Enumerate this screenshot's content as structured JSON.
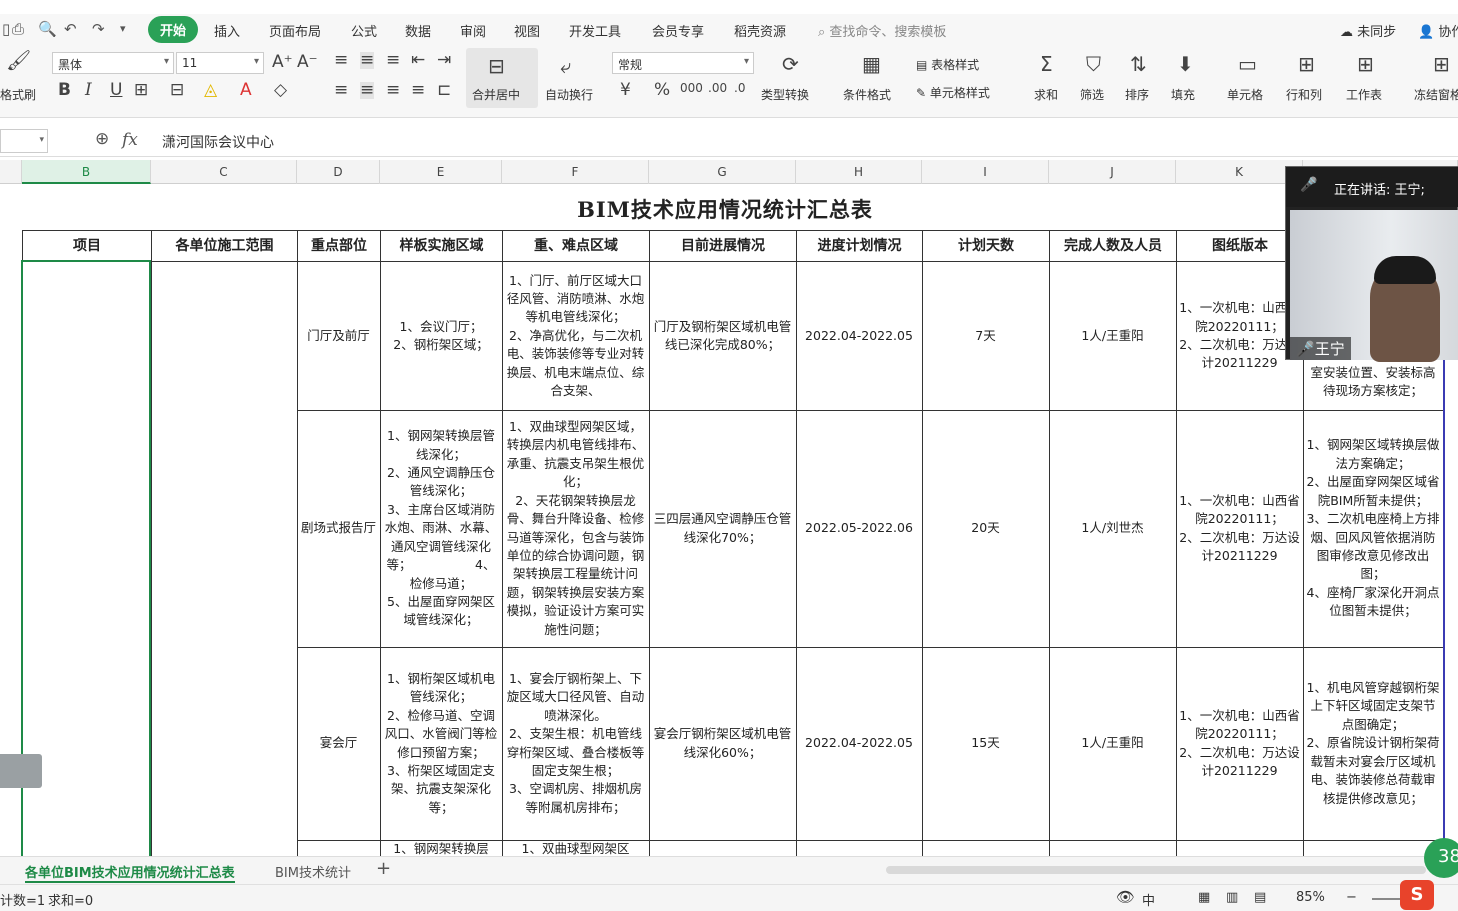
{
  "menubar": {
    "items": [
      "开始",
      "插入",
      "页面布局",
      "公式",
      "数据",
      "审阅",
      "视图",
      "开发工具",
      "会员专享",
      "稻壳资源"
    ],
    "search_placeholder": "查找命令、搜索模板",
    "sync": "未同步",
    "collab": "协作"
  },
  "ribbon": {
    "format_brush": "格式刷",
    "font_name": "黑体",
    "font_size": "11",
    "merge_center": "合并居中",
    "wrap_text": "自动换行",
    "number_format": "常规",
    "type_convert": "类型转换",
    "cond_format": "条件格式",
    "table_style": "表格样式",
    "cell_style": "单元格样式",
    "sum": "求和",
    "filter": "筛选",
    "sort": "排序",
    "fill": "填充",
    "cell": "单元格",
    "row_col": "行和列",
    "worksheet": "工作表",
    "freeze": "冻结窗格"
  },
  "formula_bar": {
    "fx": "fx",
    "content": "潇河国际会议中心"
  },
  "columns": [
    "B",
    "C",
    "D",
    "E",
    "F",
    "G",
    "H",
    "I",
    "J",
    "K"
  ],
  "sheet": {
    "title": "BIM技术应用情况统计汇总表",
    "headers": [
      "项目",
      "各单位施工范围",
      "重点部位",
      "样板实施区域",
      "重、难点区域",
      "目前进展情况",
      "进度计划情况",
      "计划天数",
      "完成人数及人员",
      "图纸版本",
      ""
    ],
    "rows": [
      {
        "part": "门厅及前厅",
        "sample": "1、会议门厅；\n2、钢桁架区域；",
        "difficult": "1、门厅、前厅区域大口径风管、消防喷淋、水炮等机电管线深化；\n2、净高优化，与二次机电、装饰装修等专业对转换层、机电末端点位、综合支架、",
        "progress": "门厅及钢桁架区域机电管线已深化完成80%；",
        "plan": "2022.04-2022.05",
        "days": "7天",
        "people": "1人/王重阳",
        "drawing": "1、一次机电：山西省院20220111；\n2、二次机电：万达设计20211229",
        "issue": "室安装位置、安装标高待现场方案核定；"
      },
      {
        "part": "剧场式报告厅",
        "sample": "1、钢网架转换层管线深化；\n2、通风空调静压仓管线深化；\n3、主席台区域消防水炮、雨淋、水幕、通风空调管线深化等；                4、检修马道；\n5、出屋面穿网架区域管线深化；",
        "difficult": "1、双曲球型网架区域，转换层内机电管线排布、承重、抗震支吊架生根优化；\n2、天花钢架转换层龙骨、舞台升降设备、检修马道等深化，包含与装饰单位的综合协调问题，钢架转换层工程量统计问题，钢架转换层安装方案模拟，验证设计方案可实施性问题；",
        "progress": "三四层通风空调静压仓管线深化70%；",
        "plan": "2022.05-2022.06",
        "days": "20天",
        "people": "1人/刘世杰",
        "drawing": "1、一次机电：山西省院20220111；\n2、二次机电：万达设计20211229",
        "issue": "1、钢网架区域转换层做法方案确定；\n2、出屋面穿网架区域省院BIM所暂未提供；   3、二次机电座椅上方排烟、回风风管依据消防图审修改意见修改出图；\n4、座椅厂家深化开洞点位图暂未提供；"
      },
      {
        "part": "宴会厅",
        "sample": "1、钢桁架区域机电管线深化；\n2、检修马道、空调风口、水管阀门等检修口预留方案；               3、桁架区域固定支架、抗震支架深化等；",
        "difficult": "1、宴会厅钢桁架上、下旋区域大口径风管、自动喷淋深化。\n2、支架生根：机电管线穿桁架区域、叠合楼板等固定支架生根；\n3、空调机房、排烟机房等附属机房排布；",
        "progress": "宴会厅钢桁架区域机电管线深化60%；",
        "plan": "2022.04-2022.05",
        "days": "15天",
        "people": "1人/王重阳",
        "drawing": "1、一次机电：山西省院20220111；\n2、二次机电：万达设计20211229",
        "issue": "1、机电风管穿越钢桁架上下轩区域固定支架节点图确定；\n2、原省院设计钢桁架荷载暂未对宴会厅区域机电、装饰装修总荷载审核提供修改意见；"
      },
      {
        "part": "",
        "sample": "1、钢网架转换层",
        "difficult": "1、双曲球型网架区",
        "progress": "",
        "plan": "",
        "days": "",
        "people": "",
        "drawing": "",
        "issue": ""
      }
    ]
  },
  "sheet_tabs": [
    "各单位BIM技术应用情况统计汇总表",
    "BIM技术统计"
  ],
  "status": {
    "count": "计数=1",
    "sum": "求和=0",
    "zoom": "85%"
  },
  "video": {
    "speaking": "正在讲话: 王宁;",
    "name": "王宁"
  },
  "badge": "38",
  "colors": {
    "accent": "#2aa157",
    "selection": "#1e8a47"
  }
}
